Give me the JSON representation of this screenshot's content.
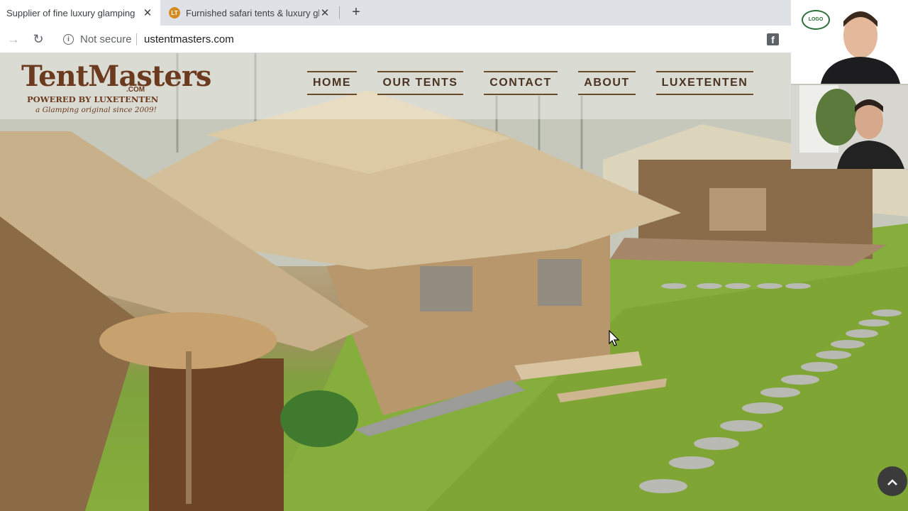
{
  "browser": {
    "tabs": [
      {
        "title": "Supplier of fine luxury glamping",
        "active": true
      },
      {
        "title": "Furnished safari tents & luxury gl",
        "active": false,
        "favicon_text": "LT"
      }
    ],
    "new_tab_symbol": "+",
    "close_symbol": "✕",
    "security_label": "Not secure",
    "url": "ustentmasters.com",
    "icons": [
      "back-icon",
      "forward-icon",
      "reload-icon",
      "info-icon",
      "star-icon",
      "facebook-extension-icon"
    ]
  },
  "site": {
    "logo": {
      "main": "TentMasters",
      "com": ".COM",
      "powered": "POWERED BY LUXETENTEN",
      "tagline": "a Glamping original since 2009!"
    },
    "menu": [
      {
        "label": "HOME"
      },
      {
        "label": "OUR TENTS"
      },
      {
        "label": "CONTACT"
      },
      {
        "label": "ABOUT"
      },
      {
        "label": "LUXETENTEN"
      }
    ],
    "scroll_top_symbol": "⌃"
  },
  "video_call": {
    "badge_text": "LOGO"
  },
  "colors": {
    "tab_strip": "#dee1e6",
    "menu_text": "#4a3322",
    "logo_brown": "#6b3a1f",
    "grass": "#86ad3b"
  }
}
